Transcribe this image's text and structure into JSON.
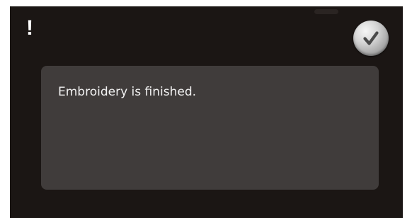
{
  "dialog": {
    "alert_icon": "!",
    "confirm_button": {
      "icon": "checkmark-icon"
    },
    "message": "Embroidery is finished."
  },
  "colors": {
    "screen_background": "#1b1614",
    "message_panel": "#403c3b",
    "text": "#f2f2f2"
  }
}
